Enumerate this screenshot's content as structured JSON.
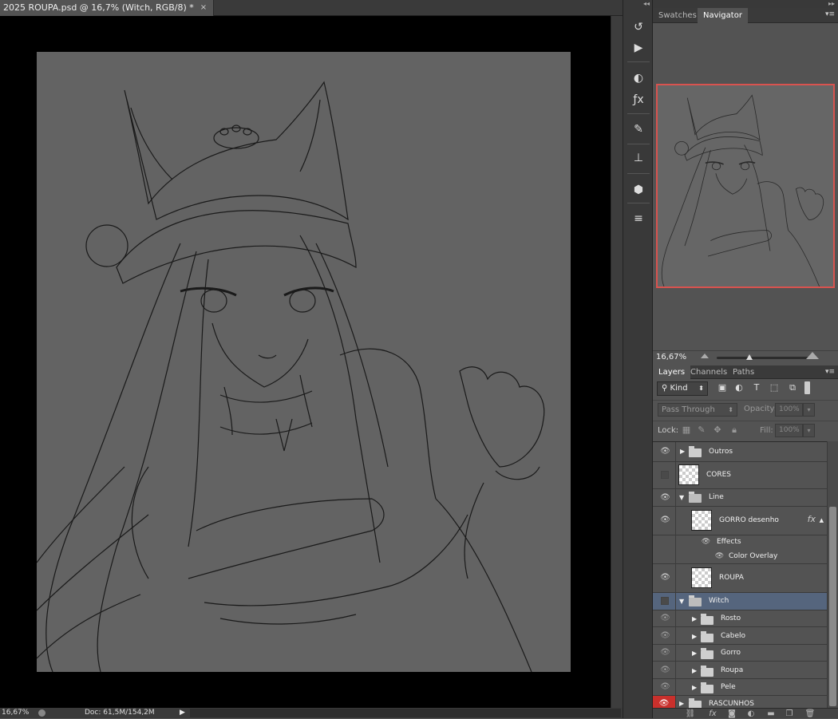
{
  "document": {
    "tab_title": "2025 ROUPA.psd @ 16,7% (Witch, RGB/8) *",
    "close_glyph": "×"
  },
  "status": {
    "zoom": "16,67%",
    "doc_size": "Doc: 61,5M/154,2M",
    "arrow": "▶"
  },
  "tool_strip": {
    "icons": [
      "history-icon",
      "actions-icon",
      "adjustments-icon",
      "styles-icon",
      "brush-presets-icon",
      "clone-source-icon",
      "3d-icon",
      "properties-icon"
    ]
  },
  "navigator": {
    "tabs": [
      "Swatches",
      "Navigator"
    ],
    "active_tab": "Navigator",
    "zoom": "16,67%"
  },
  "layers_panel": {
    "tabs": [
      "Layers",
      "Channels",
      "Paths"
    ],
    "active_tab": "Layers",
    "filter_kind": "Kind",
    "blend_mode": "Pass Through",
    "opacity_label": "Opacity:",
    "opacity_value": "100%",
    "lock_label": "Lock:",
    "fill_label": "Fill:",
    "fill_value": "100%",
    "layers": [
      {
        "name": "Outros",
        "type": "group",
        "visible": true,
        "expanded": false
      },
      {
        "name": "CORES",
        "type": "layer",
        "visible": false
      },
      {
        "name": "Line",
        "type": "group",
        "visible": true,
        "expanded": true
      },
      {
        "name": "GORRO desenho",
        "type": "layer",
        "visible": true,
        "fx": "fx"
      },
      {
        "name": "Effects",
        "type": "effects"
      },
      {
        "name": "Color Overlay",
        "type": "effect"
      },
      {
        "name": "ROUPA",
        "type": "layer",
        "visible": true
      },
      {
        "name": "Witch",
        "type": "group",
        "visible": false,
        "expanded": true,
        "selected": true
      },
      {
        "name": "Rosto",
        "type": "group",
        "visible": true
      },
      {
        "name": "Cabelo",
        "type": "group",
        "visible": true
      },
      {
        "name": "Gorro",
        "type": "group",
        "visible": true
      },
      {
        "name": "Roupa",
        "type": "group",
        "visible": true
      },
      {
        "name": "Pele",
        "type": "group",
        "visible": true
      },
      {
        "name": "RASCUNHOS",
        "type": "group",
        "visible": true,
        "flagged": true
      }
    ]
  },
  "colors": {
    "panel_bg": "#535353",
    "selected_row": "#55657d",
    "navigator_frame": "#d9534f",
    "canvas_bg": "#000000",
    "artboard": "#636363"
  }
}
